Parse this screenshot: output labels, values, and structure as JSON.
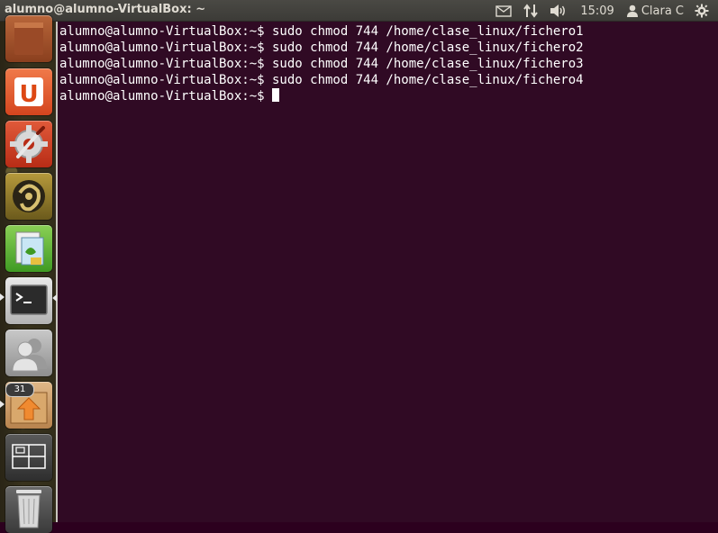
{
  "panel": {
    "title": "alumno@alumno-VirtualBox: ~",
    "clock": "15:09",
    "user_name": "Clara C",
    "icons": [
      "mail-icon",
      "network-icon",
      "sound-icon",
      "user-icon",
      "settings-gear-icon"
    ]
  },
  "launcher": {
    "items": [
      {
        "name": "shopping-bag-icon"
      },
      {
        "name": "ubuntu-one-icon",
        "glyph": "U"
      },
      {
        "name": "system-settings-icon"
      },
      {
        "name": "gimp-icon"
      },
      {
        "name": "libreoffice-icon"
      },
      {
        "name": "terminal-icon",
        "glyph": ">_"
      },
      {
        "name": "contacts-icon"
      },
      {
        "name": "software-updater-icon"
      },
      {
        "name": "workspace-switcher-icon"
      },
      {
        "name": "trash-icon"
      }
    ],
    "updater_badge": "31"
  },
  "terminal": {
    "lines": [
      "alumno@alumno-VirtualBox:~$ sudo chmod 744 /home/clase_linux/fichero1",
      "alumno@alumno-VirtualBox:~$ sudo chmod 744 /home/clase_linux/fichero2",
      "alumno@alumno-VirtualBox:~$ sudo chmod 744 /home/clase_linux/fichero3",
      "alumno@alumno-VirtualBox:~$ sudo chmod 744 /home/clase_linux/fichero4"
    ],
    "prompt": "alumno@alumno-VirtualBox:~$ "
  },
  "colors": {
    "terminal_bg": "#300a24",
    "panel_bg": "#3c3b37",
    "text": "#ffffff"
  }
}
